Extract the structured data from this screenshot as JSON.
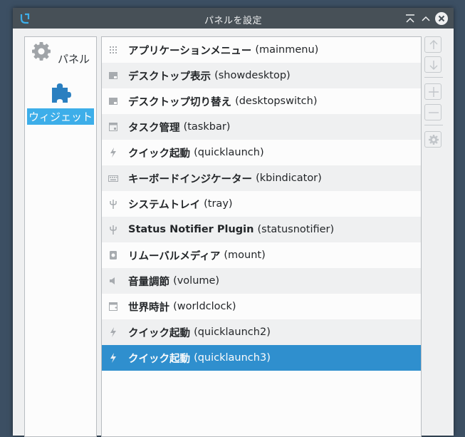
{
  "window": {
    "title": "パネルを設定"
  },
  "sidebar": {
    "items": [
      {
        "label": "パネル",
        "icon": "gear-icon",
        "selected": false
      },
      {
        "label": "ウィジェット",
        "icon": "puzzle-piece-icon",
        "selected": true
      }
    ]
  },
  "widgets": [
    {
      "name": "アプリケーションメニュー",
      "id": "(mainmenu)",
      "icon": "grid-dots-icon"
    },
    {
      "name": "デスクトップ表示",
      "id": "(showdesktop)",
      "icon": "desktop-icon"
    },
    {
      "name": "デスクトップ切り替え",
      "id": "(desktopswitch)",
      "icon": "desktop-icon"
    },
    {
      "name": "タスク管理",
      "id": "(taskbar)",
      "icon": "window-icon"
    },
    {
      "name": "クイック起動",
      "id": "(quicklaunch)",
      "icon": "lightning-icon"
    },
    {
      "name": "キーボードインジケーター",
      "id": "(kbindicator)",
      "icon": "keyboard-icon"
    },
    {
      "name": "システムトレイ",
      "id": "(tray)",
      "icon": "plug-icon"
    },
    {
      "name": "Status Notifier Plugin",
      "id": "(statusnotifier)",
      "icon": "plug-icon"
    },
    {
      "name": "リムーバルメディア",
      "id": "(mount)",
      "icon": "drive-icon"
    },
    {
      "name": "音量調節",
      "id": "(volume)",
      "icon": "speaker-icon"
    },
    {
      "name": "世界時計",
      "id": "(worldclock)",
      "icon": "calendar-icon"
    },
    {
      "name": "クイック起動",
      "id": "(quicklaunch2)",
      "icon": "lightning-icon"
    },
    {
      "name": "クイック起動",
      "id": "(quicklaunch3)",
      "icon": "lightning-icon",
      "selected": true
    }
  ],
  "actions": [
    {
      "icon": "arrow-up-icon"
    },
    {
      "icon": "arrow-down-icon"
    },
    {
      "icon": "plus-icon"
    },
    {
      "icon": "minus-icon"
    },
    {
      "icon": "configure-icon"
    }
  ],
  "colors": {
    "selection": "#2f8fce",
    "sidebar_selection": "#3daee9",
    "titlebar": "#475057"
  }
}
